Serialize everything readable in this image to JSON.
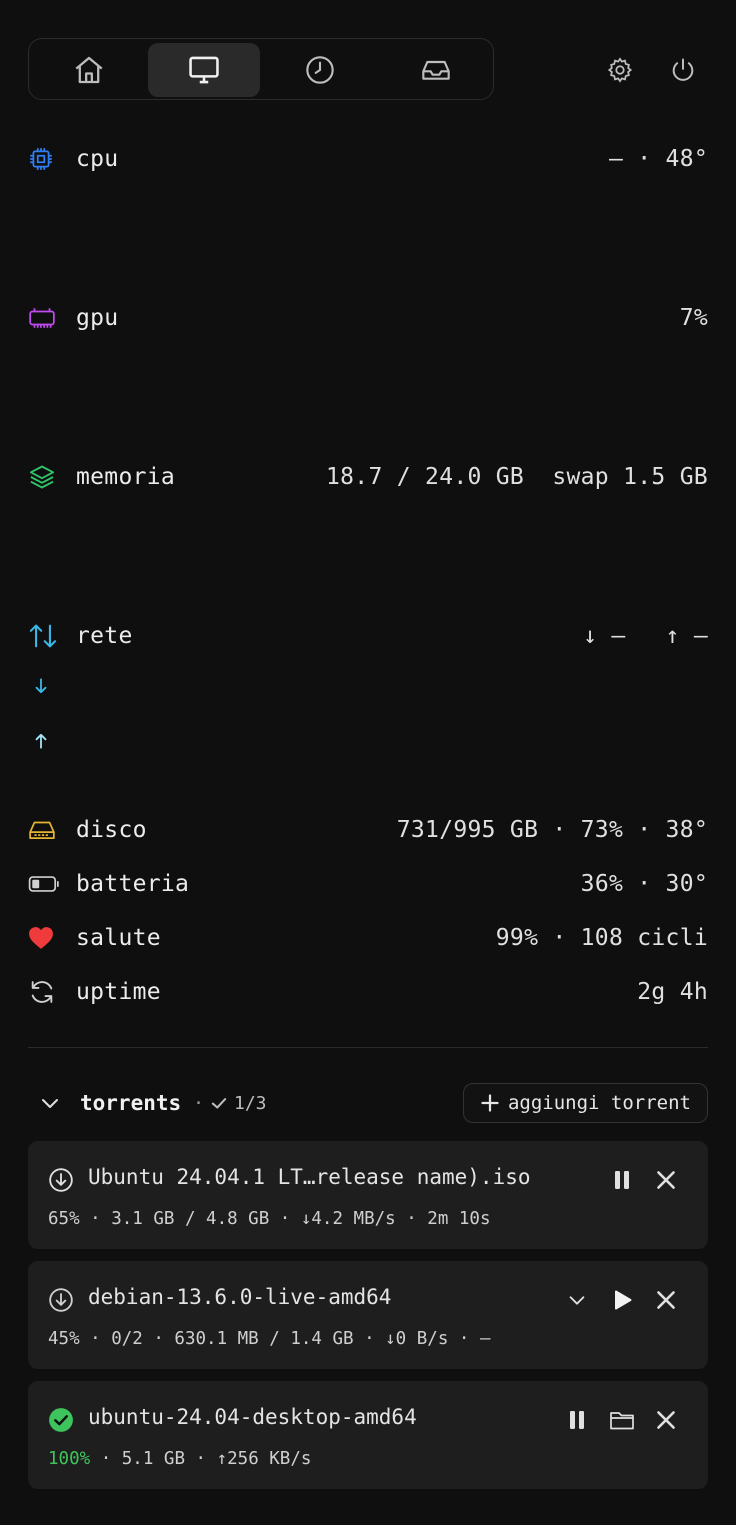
{
  "colors": {
    "background": "#0f0f0f",
    "cpu": "#2f7ff5",
    "gpu": "#c24bf0",
    "memory": "#2fc46a",
    "network": "#3ab8e8",
    "disk": "#e8b530",
    "heart": "#ef3b3b",
    "success": "#3ec45c"
  },
  "nav": {
    "tabs": [
      {
        "name": "home-icon",
        "active": false
      },
      {
        "name": "monitor-icon",
        "active": true
      },
      {
        "name": "clock-icon",
        "active": false
      },
      {
        "name": "inbox-icon",
        "active": false
      }
    ],
    "actions": [
      "gear-icon",
      "power-icon"
    ]
  },
  "metrics": {
    "cpu": {
      "label": "cpu",
      "value": "— · 48°"
    },
    "gpu": {
      "label": "gpu",
      "value": "7%"
    },
    "memory": {
      "label": "memoria",
      "value": "18.7 / 24.0 GB  swap 1.5 GB"
    },
    "network": {
      "label": "rete",
      "down": "↓ —",
      "up": "↑ —"
    },
    "disk": {
      "label": "disco",
      "value": "731/995 GB · 73% · 38°"
    },
    "battery": {
      "label": "batteria",
      "value": "36% · 30°"
    },
    "health": {
      "label": "salute",
      "value": "99% · 108 cicli"
    },
    "uptime": {
      "label": "uptime",
      "value": "2g 4h"
    }
  },
  "torrents": {
    "title": "torrents",
    "separator": "·",
    "count": "1/3",
    "add_label": "aggiungi torrent",
    "items": [
      {
        "name": "Ubuntu 24.04.1 LT…release name).iso",
        "stats": "65% · 3.1 GB / 4.8 GB · ↓4.2 MB/s · 2m 10s",
        "status": "downloading"
      },
      {
        "name": "debian-13.6.0-live-amd64",
        "stats": "45% · 0/2 · 630.1 MB / 1.4 GB · ↓0 B/s · —",
        "status": "paused"
      },
      {
        "name": "ubuntu-24.04-desktop-amd64",
        "stats_pct": "100%",
        "stats_rest": " · 5.1 GB · ↑256 KB/s",
        "status": "complete"
      }
    ]
  }
}
